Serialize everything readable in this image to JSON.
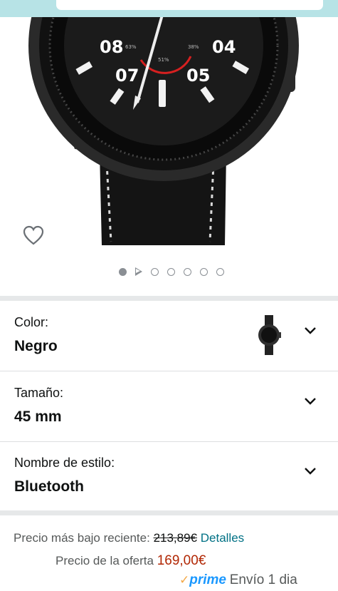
{
  "gallery": {
    "watch_numerals": [
      "08",
      "07",
      "04",
      "05"
    ],
    "subdial_labels": [
      "63%",
      "38%",
      "51%"
    ],
    "carousel": {
      "total": 7,
      "active_index": 0,
      "video_index": 1
    }
  },
  "options": [
    {
      "label": "Color:",
      "value": "Negro"
    },
    {
      "label": "Tamaño:",
      "value": "45 mm"
    },
    {
      "label": "Nombre de estilo:",
      "value": "Bluetooth"
    }
  ],
  "pricing": {
    "recent_low_label": "Precio más bajo reciente:",
    "recent_low_price": "213,89€",
    "details_link": "Detalles",
    "deal_label": "Precio de la oferta",
    "deal_price": "169,00€",
    "prime_label": "prime",
    "delivery_text": "Envío 1 dia"
  },
  "colors": {
    "banner": "#b7e3e6",
    "link": "#007185",
    "deal_price": "#b12704",
    "prime_blue": "#1a98ff",
    "prime_check": "#f3a847"
  },
  "icons": [
    "heart-icon",
    "chevron-down-icon",
    "play-icon",
    "prime-check-icon"
  ]
}
